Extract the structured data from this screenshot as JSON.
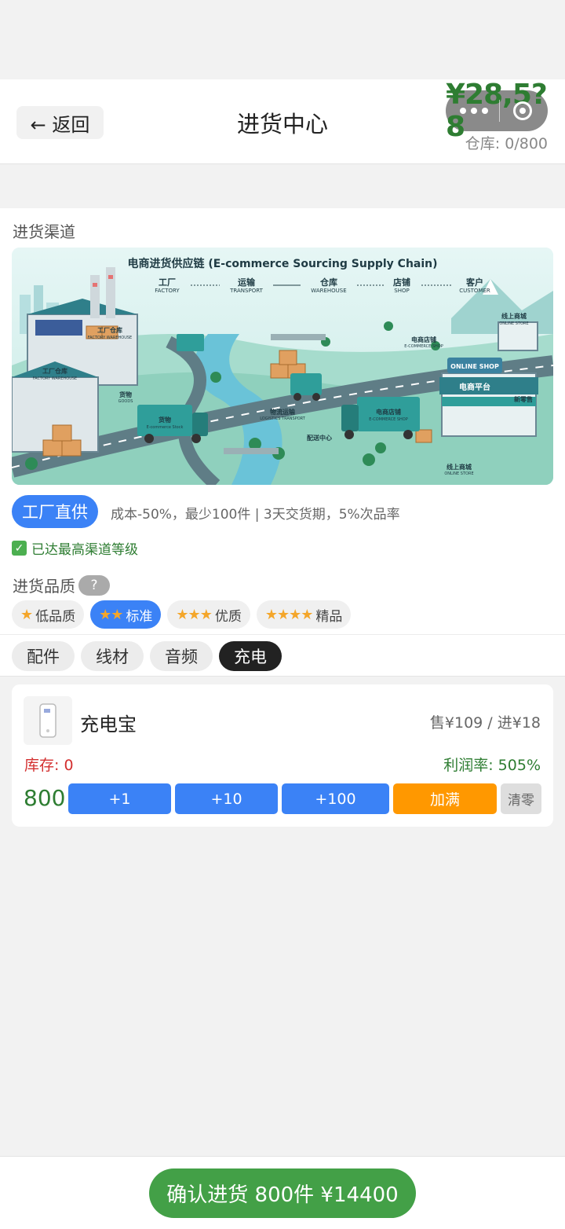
{
  "header": {
    "back_label": "← 返回",
    "title": "进货中心",
    "money": "¥28,5?8",
    "warehouse": "仓库: 0/800"
  },
  "channel": {
    "section_label": "进货渠道",
    "banner": {
      "title": "电商进货供应链 (E-commerce Sourcing Supply Chain)",
      "steps": [
        {
          "cn": "工厂",
          "en": "FACTORY"
        },
        {
          "cn": "运输",
          "en": "TRANSPORT"
        },
        {
          "cn": "仓库",
          "en": "WAREHOUSE"
        },
        {
          "cn": "店铺",
          "en": "SHOP"
        },
        {
          "cn": "客户",
          "en": "CUSTOMER"
        }
      ],
      "labels": {
        "factory_warehouse": "工厂仓库",
        "factory_warehouse_en": "FACTORY WAREHOUSE",
        "goods": "货物",
        "goods_en": "GOODS",
        "truck": "货物",
        "truck_en": "E-commerce Stock",
        "logistics": "物流运输",
        "logistics_en": "LOGISTICS TRANSPORT",
        "dist_center": "配送中心",
        "ecom_store": "电商店铺",
        "ecom_store_en": "E-COMMERCE SHOP",
        "online_mall": "线上商城",
        "online_store_en": "ONLINE STORE",
        "online_shop": "ONLINE SHOP",
        "ecom_platform": "电商平台",
        "new_retail": "新零售",
        "truck2": "电商店铺",
        "truck2_en": "E-COMMERCE SHOP"
      }
    },
    "pill": "工厂直供",
    "description": "成本-50%，最少100件 | 3天交货期，5%次品率",
    "max_level": "已达最高渠道等级"
  },
  "quality": {
    "label": "进货品质",
    "help": "?",
    "options": [
      {
        "stars": "★",
        "label": "低品质",
        "active": false
      },
      {
        "stars": "★★",
        "label": "标准",
        "active": true
      },
      {
        "stars": "★★★",
        "label": "优质",
        "active": false
      },
      {
        "stars": "★★★★",
        "label": "精品",
        "active": false
      }
    ]
  },
  "tabs": [
    {
      "label": "配件",
      "active": false
    },
    {
      "label": "线材",
      "active": false
    },
    {
      "label": "音频",
      "active": false
    },
    {
      "label": "充电",
      "active": true
    }
  ],
  "product": {
    "name": "充电宝",
    "price": "售¥109 / 进¥18",
    "stock": "库存: 0",
    "margin": "利润率: 505%",
    "qty": "800",
    "buttons": {
      "plus1": "+1",
      "plus10": "+10",
      "plus100": "+100",
      "fill": "加满",
      "clear": "清零"
    }
  },
  "footer": {
    "confirm": "确认进货 800件 ¥14400"
  },
  "colors": {
    "primary_blue": "#3b82f6",
    "green": "#43a047",
    "orange": "#ff9800",
    "red": "#d32f2f",
    "star": "#f4a62a"
  }
}
